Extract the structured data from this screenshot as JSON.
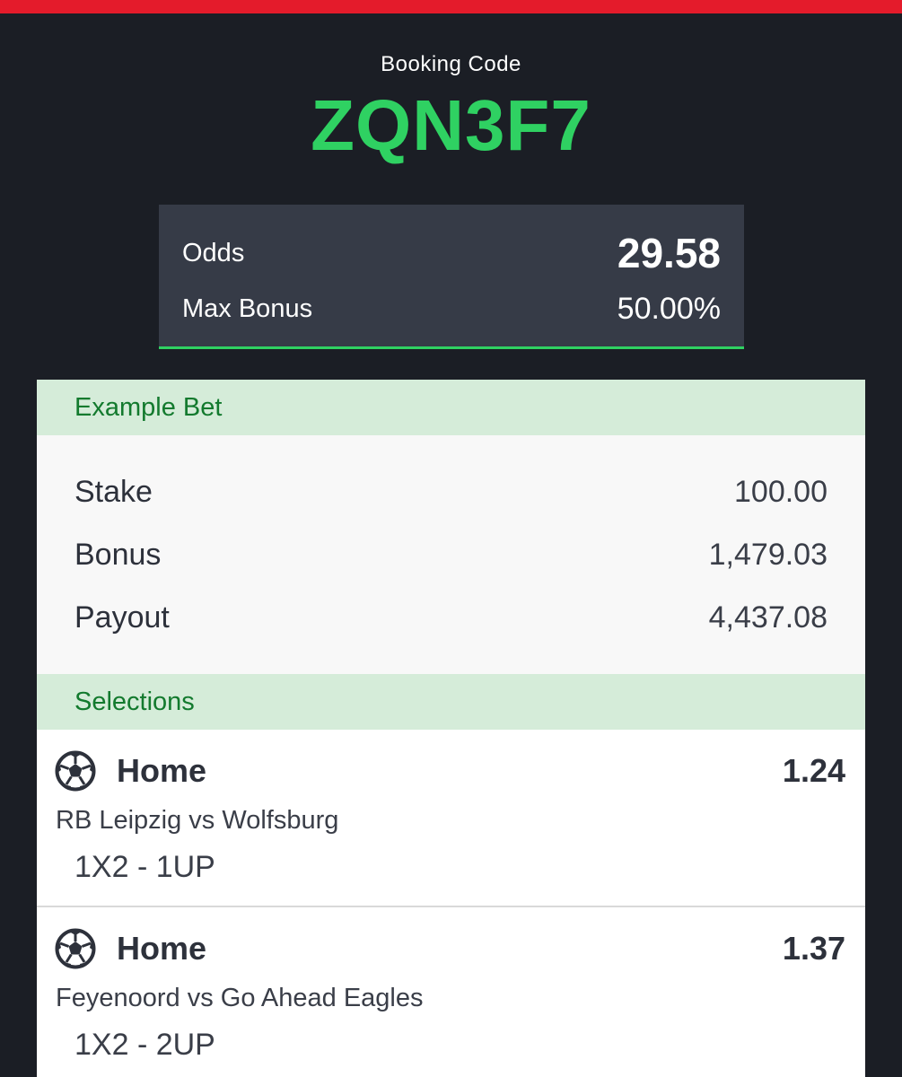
{
  "colors": {
    "top_bar": "#e41b2b",
    "background": "#1b1e25",
    "code_green": "#2fd162",
    "card": "#363b47",
    "section_header_bg": "#d5ecd9",
    "section_header_text": "#137a2e"
  },
  "booking": {
    "label": "Booking Code",
    "code": "ZQN3F7"
  },
  "summary": {
    "odds_label": "Odds",
    "odds_value": "29.58",
    "bonus_label": "Max Bonus",
    "bonus_value": "50.00%"
  },
  "example_bet": {
    "title": "Example Bet",
    "rows": [
      {
        "label": "Stake",
        "value": "100.00"
      },
      {
        "label": "Bonus",
        "value": "1,479.03"
      },
      {
        "label": "Payout",
        "value": "4,437.08"
      }
    ]
  },
  "selections": {
    "title": "Selections",
    "items": [
      {
        "icon": "soccer-ball-icon",
        "pick": "Home",
        "odds": "1.24",
        "match": "RB Leipzig vs Wolfsburg",
        "market": "1X2 - 1UP"
      },
      {
        "icon": "soccer-ball-icon",
        "pick": "Home",
        "odds": "1.37",
        "match": "Feyenoord vs Go Ahead Eagles",
        "market": "1X2 - 2UP"
      }
    ]
  }
}
